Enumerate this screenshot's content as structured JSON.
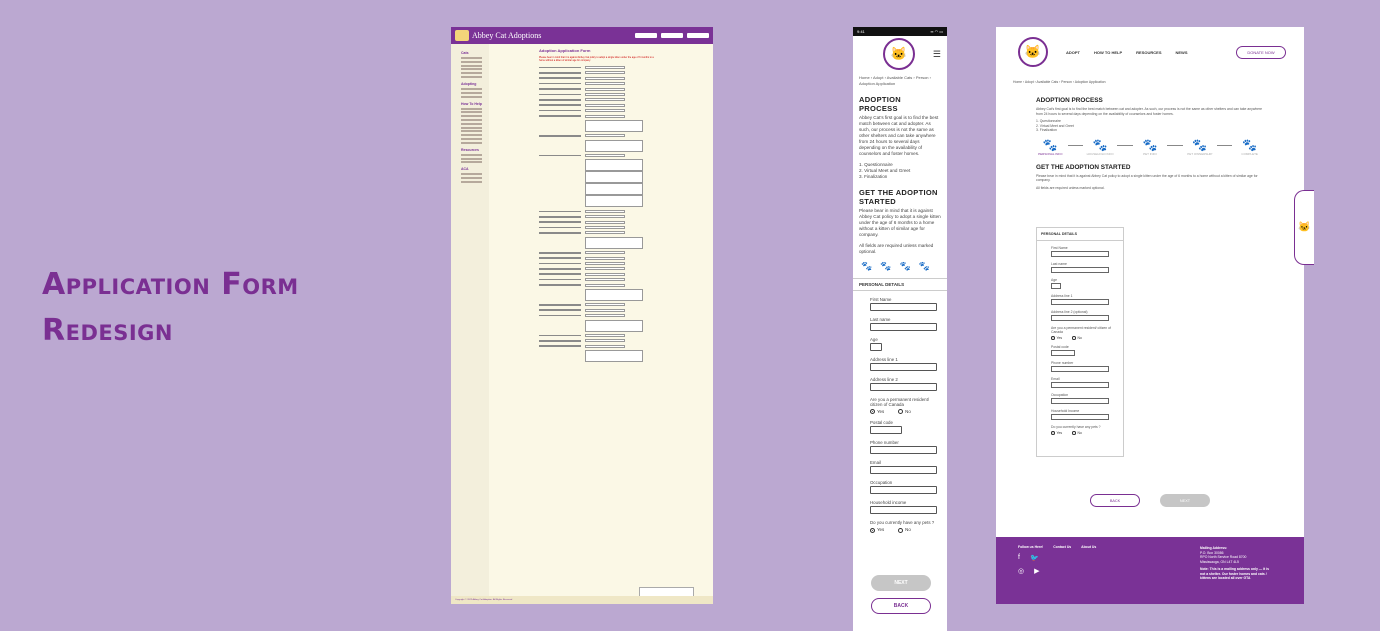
{
  "headline": {
    "line1": "Application Form",
    "line2": "Redesign"
  },
  "old_form": {
    "brand": "Abbey Cat Adoptions",
    "title": "Adoption Application Form",
    "notice": "Please bear in mind that it is against Abbey Cat policy to adopt a single kitten under the age of 6 months to a home without a kitten of similar age for company.",
    "sidebar_sections": [
      "Cats",
      "Adopting",
      "How To Help",
      "Resources",
      "ACA"
    ],
    "footer": "Copyright © 2022 Abbey Cat Adoption. All Rights Reserved"
  },
  "mobile": {
    "time": "9:41",
    "status_icons": "▪▪ ◠ ▭",
    "breadcrumb": "Home › Adopt › Available Cats › Person › Adoption Application",
    "process_title": "ADOPTION PROCESS",
    "process_text": "Abbey Cat's first goal is to find the best match between cat and adopter. As such, our process is not the same as other shelters and can take anywhere from 24 hours to several days depending on the availability of counselors and foster homes.",
    "steps": [
      "1. Questionnaire",
      "2. Virtual Meet and Greet",
      "3. Finalization"
    ],
    "started_title": "GET THE ADOPTION STARTED",
    "started_text": "Please bear in mind that it is against Abbey Cat policy to adopt a single kitten under the age of 6 months to a home without a kitten of similar age for company.",
    "required_note": "All fields are required unless marked optional.",
    "section": "PERSONAL DETAILS",
    "fields": [
      "First Name",
      "Last name",
      "Age",
      "Address line 1",
      "Address line 2",
      "Are you a permanent resident/ citizen of Canada",
      "Postal code",
      "Phone number",
      "Email",
      "Occupation",
      "Household income",
      "Do you currently have any pets ?"
    ],
    "yes": "Yes",
    "no": "No",
    "next": "NEXT",
    "back": "BACK"
  },
  "desktop": {
    "nav": [
      "ADOPT",
      "HOW TO HELP",
      "RESOURCES",
      "NEWS"
    ],
    "donate": "DONATE NOW",
    "breadcrumb": "Home › Adopt › Available Cats › Person › Adoption Application",
    "process_title": "ADOPTION PROCESS",
    "process_text": "Abbey Cat's first goal is to find the best match between cat and adopter. As such, our process is not the same as other shelters and can take anywhere from 24 hours to several days depending on the availability of counselors and foster homes.",
    "steps": [
      "1. Questionnaire",
      "2. Virtual Meet and Greet",
      "3. Finalization"
    ],
    "progress": [
      "PERSONAL INFO",
      "HOUSEHOLD INFO",
      "PET INFO",
      "PET OWNERSHIP",
      "COMPLETE"
    ],
    "started_title": "GET THE ADOPTION STARTED",
    "started_text": "Please bear in mind that it is against Abbey Cat policy to adopt a single kitten under the age of 6 months to a home without a kitten of similar age for company.",
    "required_note": "All fields are required unless marked optional.",
    "section": "PERSONAL DETAILS",
    "fields": [
      "First Name",
      "Last name",
      "Age",
      "Address line 1",
      "Address line 2 (optional)",
      "Are you a permanent resident/ citizen of Canada",
      "Postal code",
      "Phone number",
      "Email",
      "Occupation",
      "Household Income",
      "Do you currently have any pets ?"
    ],
    "yes": "Yes",
    "no": "No",
    "back": "BACK",
    "next": "NEXT",
    "footer": {
      "links": [
        "Follow us Here!",
        "Contact Us",
        "About Us"
      ],
      "mailing_title": "Mailing Address:",
      "mailing_lines": [
        "P.O. Box 30086",
        "RPO North Service Road 8700",
        "Mississauga, ON L4T 4L5"
      ],
      "note": "Note: This is a mailing address only — it is not a shelter. Our foster homes and cats / kittens are located all over GTA"
    }
  }
}
